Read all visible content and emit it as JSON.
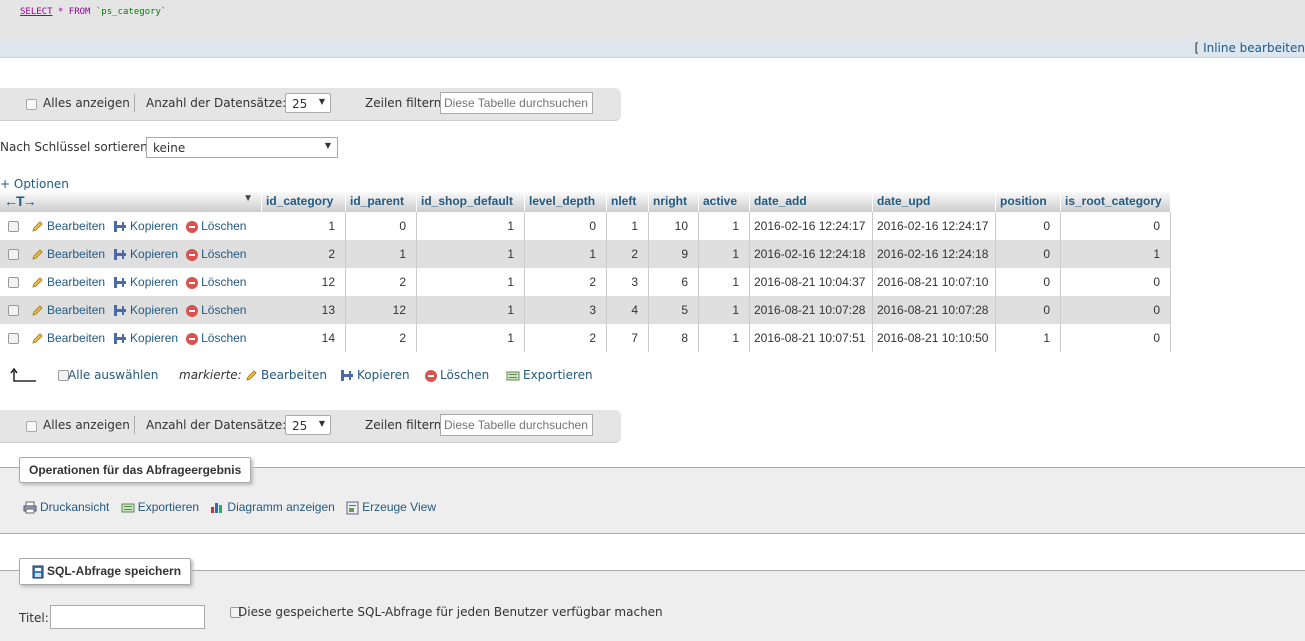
{
  "sql": {
    "select": "SELECT",
    "star": "*",
    "from": "FROM",
    "table": "`ps_category`"
  },
  "inline_edit": {
    "bracket": "[",
    "label": "Inline bearbeiten"
  },
  "nav": {
    "show_all": "Alles anzeigen",
    "rows_label": "Anzahl der Datensätze:",
    "rows_value": "25",
    "filter_label": "Zeilen filtern:",
    "filter_placeholder": "Diese Tabelle durchsuchen"
  },
  "sort": {
    "label": "Nach Schlüssel sortieren:",
    "value": "keine"
  },
  "options_link": "+ Optionen",
  "table": {
    "arrows": "←T→",
    "columns": [
      "id_category",
      "id_parent",
      "id_shop_default",
      "level_depth",
      "nleft",
      "nright",
      "active",
      "date_add",
      "date_upd",
      "position",
      "is_root_category"
    ],
    "actions": {
      "edit": "Bearbeiten",
      "copy": "Kopieren",
      "delete": "Löschen"
    },
    "rows": [
      [
        "1",
        "0",
        "1",
        "0",
        "1",
        "10",
        "1",
        "2016-02-16 12:24:17",
        "2016-02-16 12:24:17",
        "0",
        "0"
      ],
      [
        "2",
        "1",
        "1",
        "1",
        "2",
        "9",
        "1",
        "2016-02-16 12:24:18",
        "2016-02-16 12:24:18",
        "0",
        "1"
      ],
      [
        "12",
        "2",
        "1",
        "2",
        "3",
        "6",
        "1",
        "2016-08-21 10:04:37",
        "2016-08-21 10:07:10",
        "0",
        "0"
      ],
      [
        "13",
        "12",
        "1",
        "3",
        "4",
        "5",
        "1",
        "2016-08-21 10:07:28",
        "2016-08-21 10:07:28",
        "0",
        "0"
      ],
      [
        "14",
        "2",
        "1",
        "2",
        "7",
        "8",
        "1",
        "2016-08-21 10:07:51",
        "2016-08-21 10:10:50",
        "1",
        "0"
      ]
    ]
  },
  "bulk": {
    "select_all": "Alle auswählen",
    "marked": "markierte:",
    "edit": "Bearbeiten",
    "copy": "Kopieren",
    "delete": "Löschen",
    "export": "Exportieren"
  },
  "operations": {
    "legend": "Operationen für das Abfrageergebnis",
    "print": "Druckansicht",
    "export": "Exportieren",
    "chart": "Diagramm anzeigen",
    "view": "Erzeuge View"
  },
  "bookmark": {
    "legend": "SQL-Abfrage speichern",
    "title_label": "Titel:",
    "share_label": "Diese gespeicherte SQL-Abfrage für jeden Benutzer verfügbar machen"
  }
}
